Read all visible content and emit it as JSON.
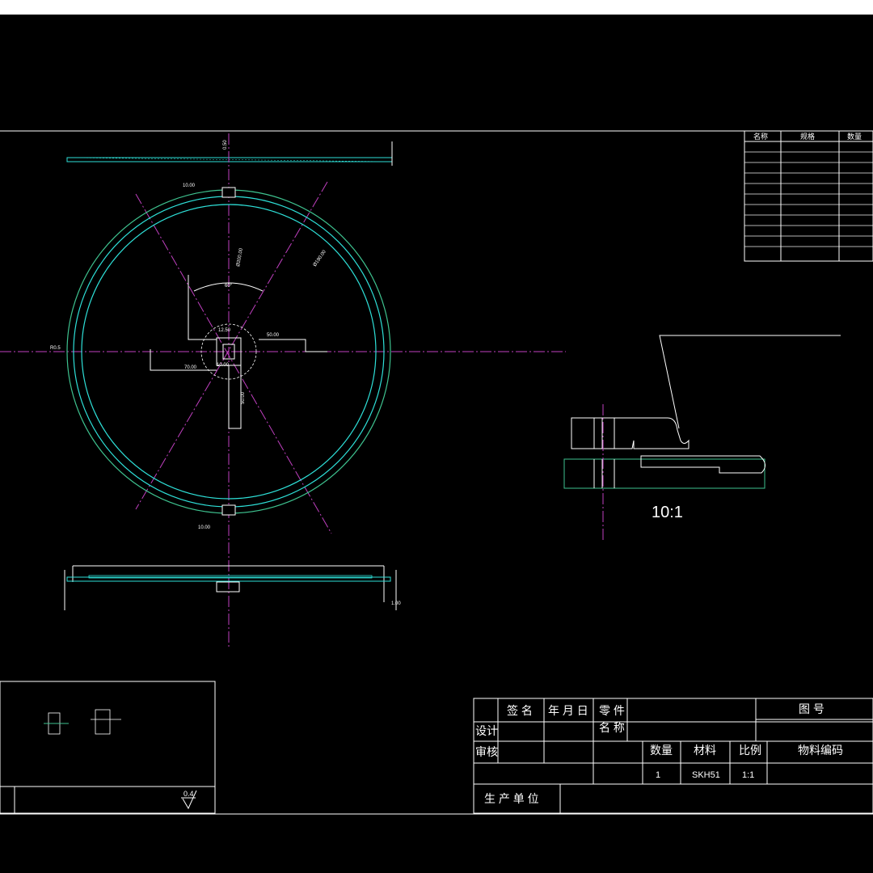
{
  "title_block": {
    "sign_label": "签 名",
    "date_label": "年 月 日",
    "part_label_1": "零 件",
    "part_label_2": "名 称",
    "drawing_no_label": "图 号",
    "design_label": "设计",
    "review_label": "审核",
    "qty_label": "数量",
    "material_label": "材料",
    "scale_label": "比例",
    "code_label": "物料编码",
    "qty_value": "1",
    "material_value": "SKH51",
    "scale_value": "1:1",
    "maker_label": "生 产 单 位"
  },
  "parts_table": {
    "headers": [
      "名称",
      "规格",
      "数量"
    ]
  },
  "detail": {
    "scale_note": "10:1"
  },
  "roughness": {
    "value": "0.4"
  },
  "dimensions": {
    "width_top": "10.00",
    "width_bottom": "10.00",
    "dia_outer": "Ø200.00",
    "dia_inner": "Ø190.00",
    "center_x": "50.00",
    "center_y": "50.00",
    "left_offset": "70.00",
    "angle": "60°",
    "small_1": "12.50",
    "small_2": "10.00",
    "edge_note": "R0.5",
    "top_thk": "0.50",
    "bottom_thk": "1.00"
  },
  "colors": {
    "background": "#000000",
    "line": "#ffffff",
    "ring_outer": "#3ec28f",
    "ring_inner": "#2ee0d8",
    "centerline": "#c040c0"
  }
}
